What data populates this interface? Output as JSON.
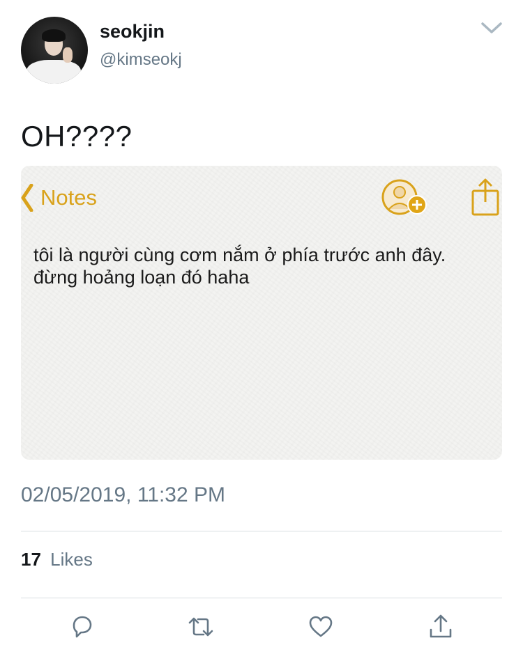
{
  "user": {
    "display_name": "seokjin",
    "handle": "@kimseokj"
  },
  "tweet": {
    "text": "OH????",
    "timestamp": "02/05/2019, 11:32 PM"
  },
  "media": {
    "app_title": "Notes",
    "note_lines": [
      "tôi là người cùng cơm nắm ở phía trước anh đây.",
      "đừng hoảng loạn đó haha"
    ],
    "accent_color": "#d9a21b"
  },
  "stats": {
    "likes_count": "17",
    "likes_label": "Likes"
  },
  "icons": {
    "menu": "chevron-down-icon",
    "reply": "reply-icon",
    "retweet": "retweet-icon",
    "like": "heart-icon",
    "share": "share-icon"
  },
  "colors": {
    "text_primary": "#14171a",
    "text_secondary": "#657786",
    "divider": "#d8dde1",
    "icon": "#657786"
  }
}
